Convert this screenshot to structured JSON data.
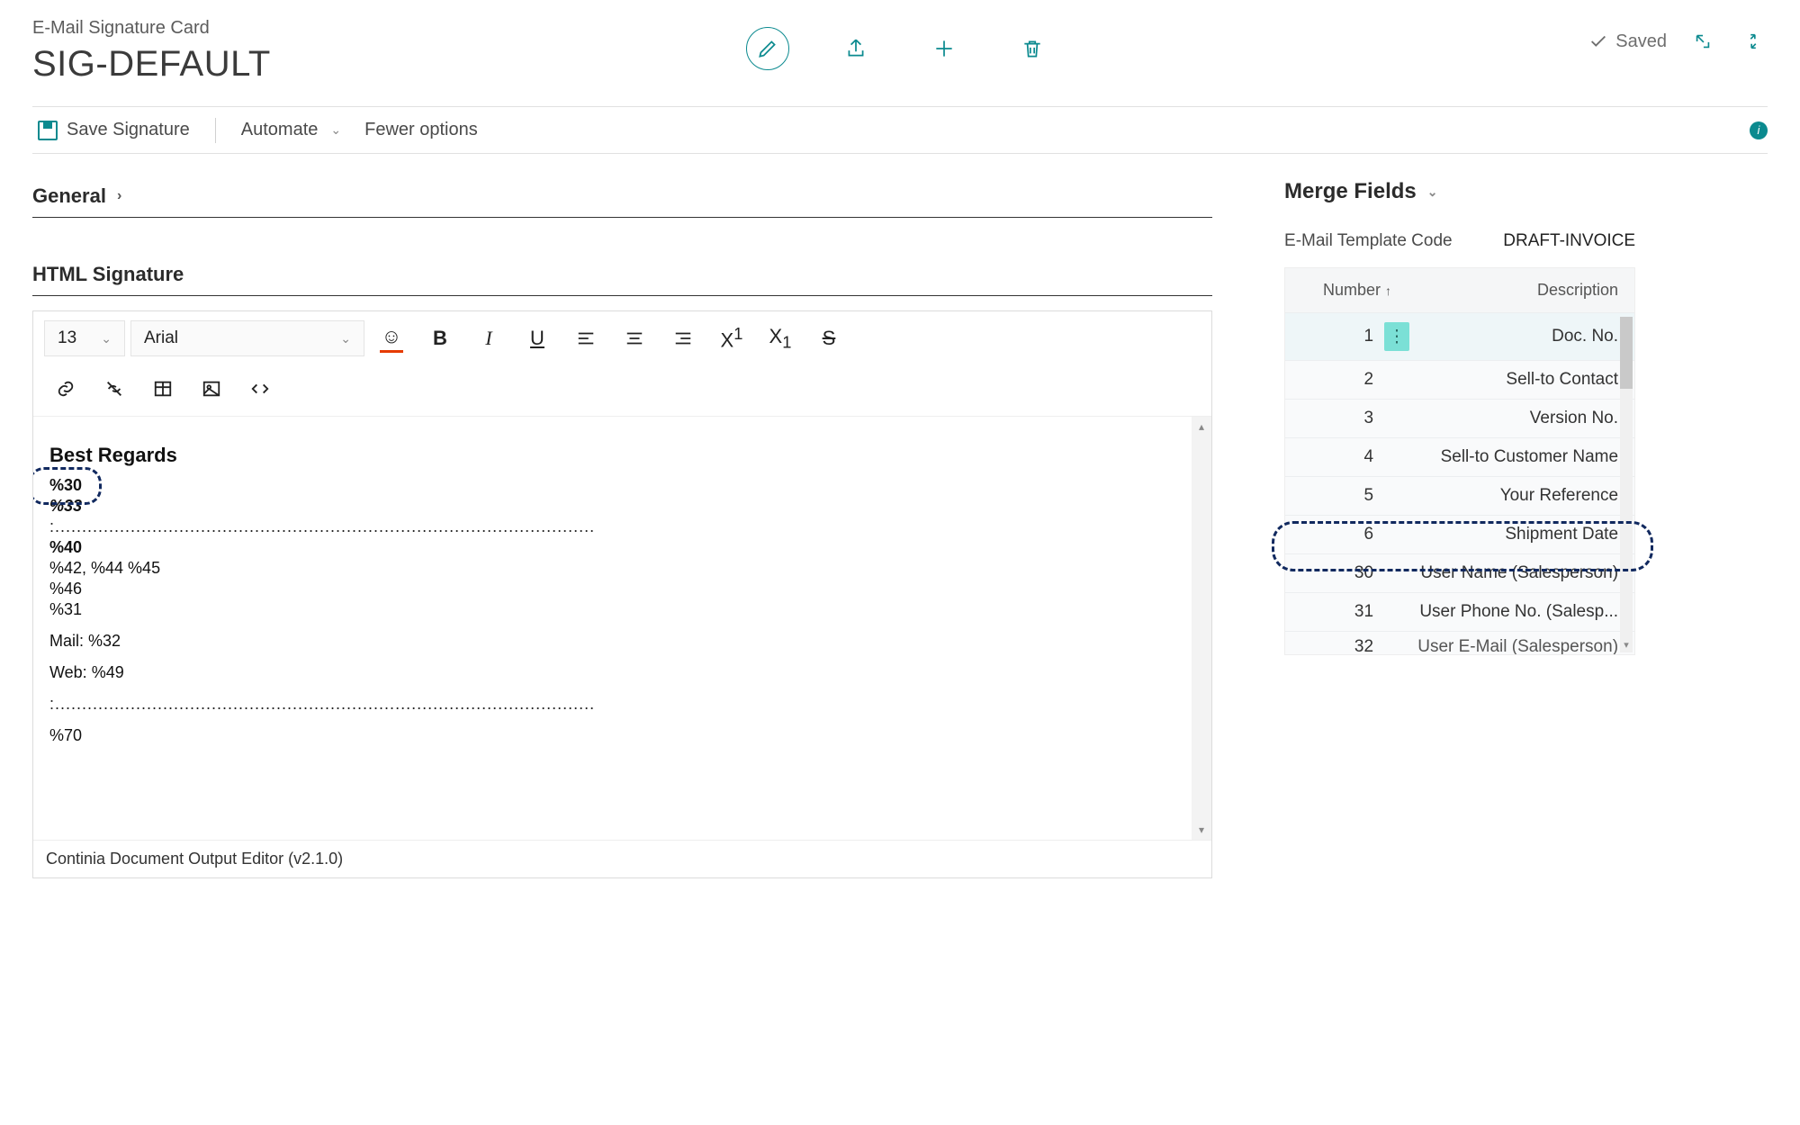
{
  "header": {
    "breadcrumb": "E-Mail Signature Card",
    "title": "SIG-DEFAULT",
    "saved_label": "Saved"
  },
  "toolbar": {
    "save_label": "Save Signature",
    "automate_label": "Automate",
    "fewer_options_label": "Fewer options"
  },
  "sections": {
    "general": "General",
    "html_signature": "HTML Signature"
  },
  "editor": {
    "font_size": "13",
    "font_family": "Arial",
    "body": {
      "heading": "Best Regards",
      "line_30": "%30",
      "line_33": "%33",
      "dots": ":....................................................................................................",
      "line_40": "%40",
      "line_42": "%42, %44 %45",
      "line_46": "%46",
      "line_31": "%31",
      "mail": "Mail: %32",
      "web": "Web: %49",
      "dots2": ":....................................................................................................",
      "line_70": "%70"
    },
    "footer": "Continia Document Output Editor (v2.1.0)"
  },
  "side": {
    "title": "Merge Fields",
    "template_code_label": "E-Mail Template Code",
    "template_code_value": "DRAFT-INVOICE",
    "columns": {
      "number": "Number",
      "description": "Description"
    },
    "rows": [
      {
        "num": "1",
        "desc": "Doc. No."
      },
      {
        "num": "2",
        "desc": "Sell-to Contact"
      },
      {
        "num": "3",
        "desc": "Version No."
      },
      {
        "num": "4",
        "desc": "Sell-to Customer Name"
      },
      {
        "num": "5",
        "desc": "Your Reference"
      },
      {
        "num": "6",
        "desc": "Shipment Date"
      },
      {
        "num": "30",
        "desc": "User Name (Salesperson)"
      },
      {
        "num": "31",
        "desc": "User Phone No. (Salesp..."
      },
      {
        "num": "32",
        "desc": "User E-Mail (Salesperson)"
      }
    ]
  }
}
